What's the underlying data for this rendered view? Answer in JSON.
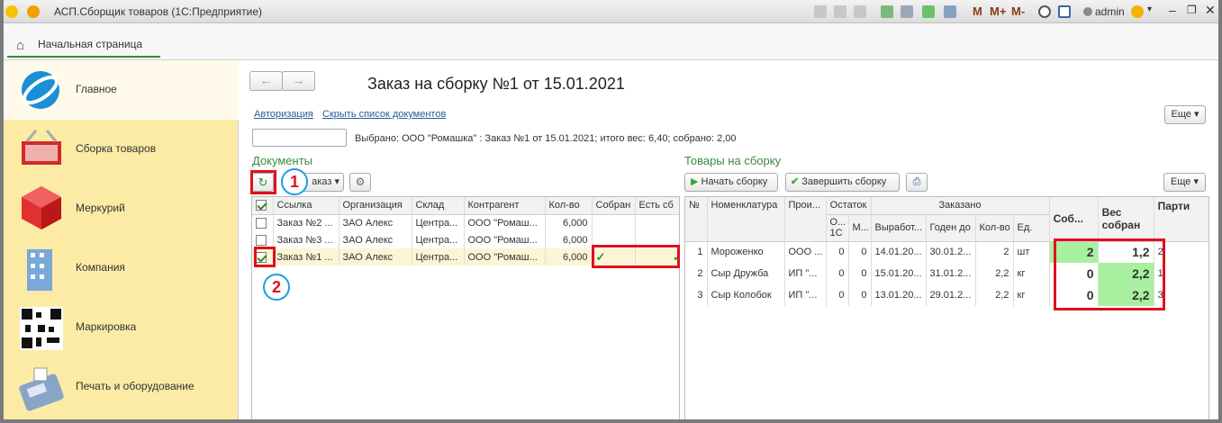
{
  "window": {
    "title": "АСП.Сборщик товаров  (1С:Предприятие)",
    "toolbar_m": "M",
    "toolbar_mplus": "M+",
    "toolbar_mminus": "M-",
    "user": "admin"
  },
  "home_tab": "Начальная страница",
  "sidebar": {
    "items": [
      {
        "label": "Главное",
        "icon": "globe-icon"
      },
      {
        "label": "Сборка товаров",
        "icon": "basket-icon"
      },
      {
        "label": "Меркурий",
        "icon": "cube-icon"
      },
      {
        "label": "Компания",
        "icon": "building-icon"
      },
      {
        "label": "Маркировка",
        "icon": "qr-code-icon"
      },
      {
        "label": "Печать и оборудование",
        "icon": "pos-terminal-icon"
      }
    ]
  },
  "form": {
    "title": "Заказ на сборку №1 от 15.01.2021",
    "link_auth": "Авторизация",
    "link_hide": "Скрыть список документов",
    "more_label": "Еще",
    "status": "Выбрано: ООО \"Ромашка\" : Заказ №1 от 15.01.2021; итого вес: 6,40; собрано: 2,00"
  },
  "documents": {
    "title": "Документы",
    "order_btn": "аказ",
    "columns": [
      "Ссылка",
      "Организация",
      "Склад",
      "Контрагент",
      "Кол-во",
      "Собран",
      "Есть сб"
    ],
    "rows": [
      {
        "ref": "Заказ №2 ...",
        "org": "ЗАО Алекс",
        "wh": "Центра...",
        "ctr": "ООО \"Ромаш...",
        "qty": "6,000",
        "checked": false
      },
      {
        "ref": "Заказ №3 ...",
        "org": "ЗАО Алекс",
        "wh": "Центра...",
        "ctr": "ООО \"Ромаш...",
        "qty": "6,000",
        "checked": false
      },
      {
        "ref": "Заказ №1 ...",
        "org": "ЗАО Алекс",
        "wh": "Центра...",
        "ctr": "ООО \"Ромаш...",
        "qty": "6,000",
        "checked": true
      }
    ]
  },
  "goods": {
    "title": "Товары на сборку",
    "start_btn": "Начать сборку",
    "finish_btn": "Завершить сборку",
    "more_label": "Еще",
    "columns": {
      "num": "№",
      "nom": "Номенклатура",
      "prod": "Прои...",
      "ostatok": "Остаток",
      "zakazano": "Заказано",
      "o1c": "О... 1С",
      "m": "М...",
      "vyrab": "Выработ...",
      "goden": "Годен до",
      "kolvo": "Кол-во",
      "ed": "Ед.",
      "sobr": "Соб...",
      "ves": "Вес собран",
      "party": "Парти"
    },
    "rows": [
      {
        "n": "1",
        "name": "Мороженко",
        "prod": "ООО ...",
        "o1c": "0",
        "m": "0",
        "vyr": "14.01.20...",
        "god": "30.01.2...",
        "qty": "2",
        "ed": "шт",
        "sobr": "2",
        "ves": "1,2",
        "party": "2"
      },
      {
        "n": "2",
        "name": "Сыр Дружба",
        "prod": "ИП \"...",
        "o1c": "0",
        "m": "0",
        "vyr": "15.01.20...",
        "god": "31.01.2...",
        "qty": "2,2",
        "ed": "кг",
        "sobr": "0",
        "ves": "2,2",
        "party": "1"
      },
      {
        "n": "3",
        "name": "Сыр Колобок",
        "prod": "ИП \"...",
        "o1c": "0",
        "m": "0",
        "vyr": "13.01.20...",
        "god": "29.01.2...",
        "qty": "2,2",
        "ed": "кг",
        "sobr": "0",
        "ves": "2,2",
        "party": "3"
      }
    ]
  },
  "annotations": {
    "badge1": "1",
    "badge2": "2"
  },
  "colors": {
    "accent_green": "#3e8a3e",
    "sidebar_bg": "#fbeba5",
    "highlight_red": "#e0101e",
    "badge_blue": "#1a9ee0",
    "cell_green": "#a8f0a0"
  }
}
